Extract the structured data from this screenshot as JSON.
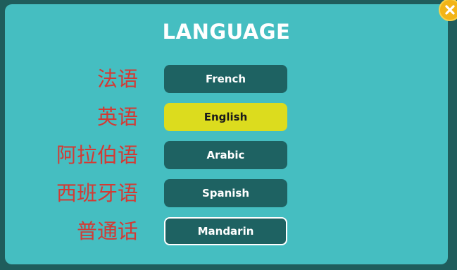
{
  "dialog": {
    "title": "LANGUAGE",
    "close_icon": "close-icon"
  },
  "languages": [
    {
      "native_label": "法语",
      "button_label": "French",
      "state": "default"
    },
    {
      "native_label": "英语",
      "button_label": "English",
      "state": "selected"
    },
    {
      "native_label": "阿拉伯语",
      "button_label": "Arabic",
      "state": "default"
    },
    {
      "native_label": "西班牙语",
      "button_label": "Spanish",
      "state": "default"
    },
    {
      "native_label": "普通话",
      "button_label": "Mandarin",
      "state": "focused"
    }
  ],
  "colors": {
    "panel_bg": "#45bec1",
    "frame_bg": "#1f5d5c",
    "button_bg": "#1e6262",
    "selected_bg": "#dcdc1e",
    "native_label": "#d33a34",
    "close_bg": "#f2b417"
  }
}
